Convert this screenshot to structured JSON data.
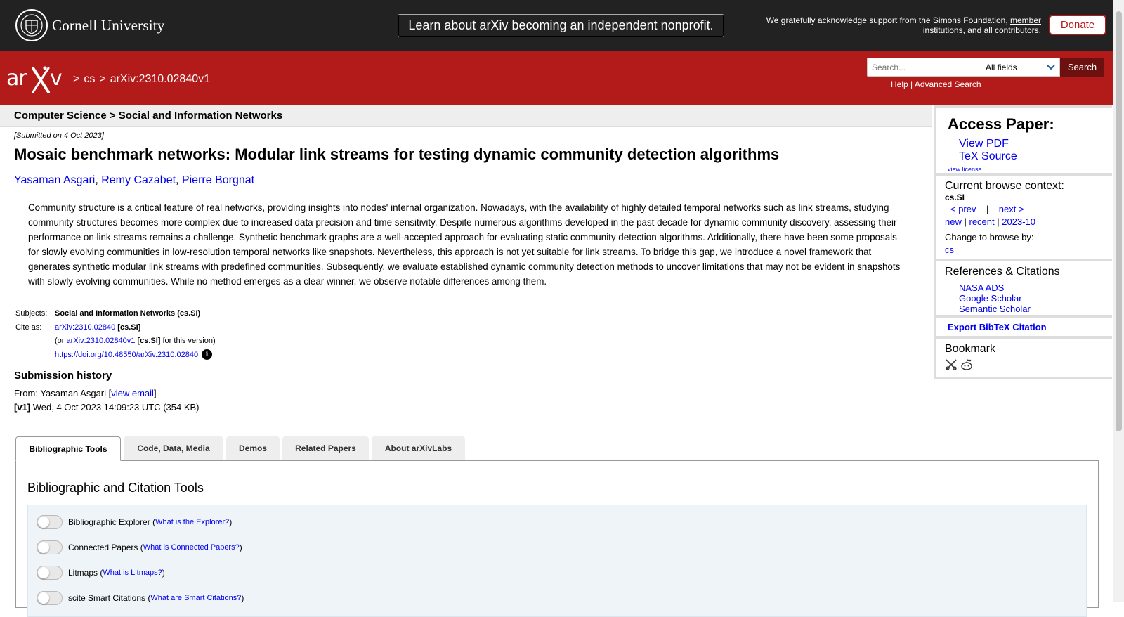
{
  "top": {
    "university": "Cornell University",
    "announcement": "Learn about arXiv becoming an independent nonprofit.",
    "ack_pre": "We gratefully acknowledge support from the Simons Foundation, ",
    "ack_link": "member institutions",
    "ack_post": ", and all contributors.",
    "donate": "Donate"
  },
  "header": {
    "crumbs": [
      ">",
      "cs",
      ">",
      "arXiv:2310.02840v1"
    ],
    "search_placeholder": "Search...",
    "search_field": "All fields",
    "search_button": "Search",
    "help": "Help",
    "sep": " | ",
    "advanced": "Advanced Search"
  },
  "main": {
    "subject_header": "Computer Science > Social and Information Networks",
    "submitted": "[Submitted on 4 Oct 2023]",
    "title": "Mosaic benchmark networks: Modular link streams for testing dynamic community detection algorithms",
    "authors": [
      "Yasaman Asgari",
      "Remy Cazabet",
      "Pierre Borgnat"
    ],
    "author_sep": ", ",
    "abstract": "Community structure is a critical feature of real networks, providing insights into nodes' internal organization. Nowadays, with the availability of highly detailed temporal networks such as link streams, studying community structures becomes more complex due to increased data precision and time sensitivity. Despite numerous algorithms developed in the past decade for dynamic community discovery, assessing their performance on link streams remains a challenge. Synthetic benchmark graphs are a well-accepted approach for evaluating static community detection algorithms. Additionally, there have been some proposals for slowly evolving communities in low-resolution temporal networks like snapshots. Nevertheless, this approach is not yet suitable for link streams. To bridge this gap, we introduce a novel framework that generates synthetic modular link streams with predefined communities. Subsequently, we evaluate established dynamic community detection methods to uncover limitations that may not be evident in snapshots with slowly evolving communities. While no method emerges as a clear winner, we observe notable differences among them.",
    "subjects_label": "Subjects:",
    "subjects_value": "Social and Information Networks (cs.SI)",
    "cite_label": "Cite as:",
    "cite_id": "arXiv:2310.02840",
    "cite_tag": " [cs.SI]",
    "cite_or_pre": "(or ",
    "cite_version_id": "arXiv:2310.02840v1",
    "cite_version_tag": " [cs.SI]",
    "cite_version_post": " for this version)",
    "doi": "https://doi.org/10.48550/arXiv.2310.02840",
    "info_glyph": "i",
    "history_title": "Submission history",
    "history_from_pre": "From: Yasaman Asgari [",
    "history_view_email": "view email",
    "history_from_post": "]",
    "history_version": "[v1]",
    "history_date": " Wed, 4 Oct 2023 14:09:23 UTC (354 KB)"
  },
  "tabs": [
    {
      "label": "Bibliographic Tools"
    },
    {
      "label": "Code, Data, Media"
    },
    {
      "label": "Demos"
    },
    {
      "label": "Related Papers"
    },
    {
      "label": "About arXivLabs"
    }
  ],
  "panel": {
    "title": "Bibliographic and Citation Tools",
    "tools": [
      {
        "name": "Bibliographic Explorer",
        "link": "What is the Explorer?"
      },
      {
        "name": "Connected Papers",
        "link": "What is Connected Papers?"
      },
      {
        "name": "Litmaps",
        "link": "What is Litmaps?"
      },
      {
        "name": "scite Smart Citations",
        "link": "What are Smart Citations?"
      }
    ]
  },
  "sidebar": {
    "access_title": "Access Paper:",
    "view_pdf": "View PDF",
    "tex_source": "TeX Source",
    "view_license": "view license",
    "context_title": "Current browse context:",
    "context_value": "cs.SI",
    "prev": "< prev",
    "nav_sep": "|",
    "next": "next >",
    "new": "new",
    "recent": "recent",
    "month": "2023-10",
    "change_browse": "Change to browse by:",
    "browse_cs": "cs",
    "refs_title": "References & Citations",
    "nasa": "NASA ADS",
    "google": "Google Scholar",
    "semantic": "Semantic Scholar",
    "export_bibtex": "Export BibTeX Citation",
    "bookmark_title": "Bookmark"
  },
  "colors": {
    "arxiv_red": "#b31b1b",
    "top_bar": "#222222",
    "link": "#0000ee"
  }
}
